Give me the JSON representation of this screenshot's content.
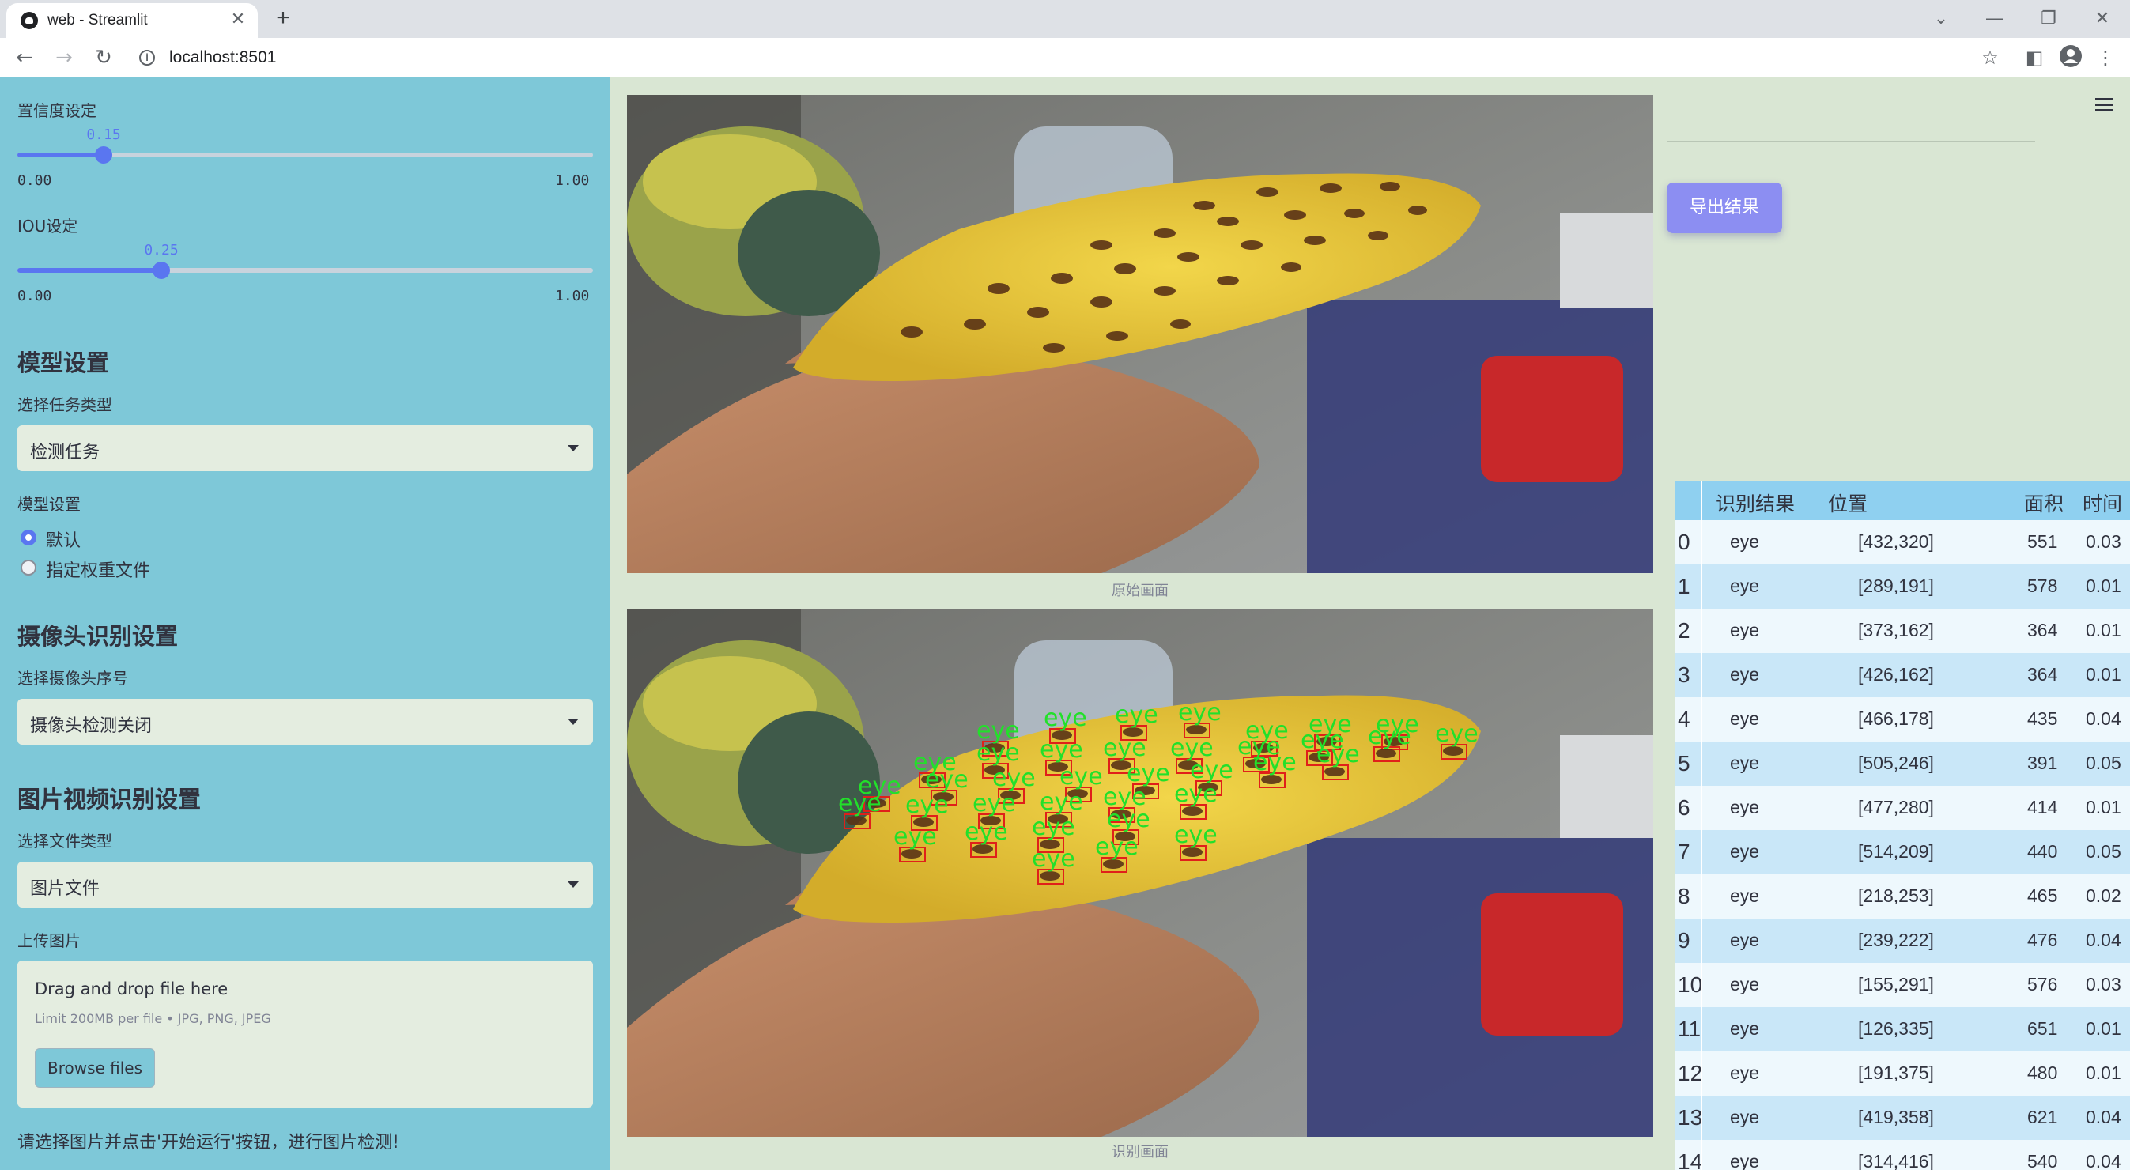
{
  "browser": {
    "tab_title": "web - Streamlit",
    "tab_close": "✕",
    "new_tab": "+",
    "url": "localhost:8501",
    "info_glyph": "i",
    "window_controls": [
      "⌄",
      "—",
      "❐",
      "✕"
    ]
  },
  "sidebar": {
    "confidence": {
      "label": "置信度设定",
      "value": "0.15",
      "value_num": 0.15,
      "min": "0.00",
      "max": "1.00"
    },
    "iou": {
      "label": "IOU设定",
      "value": "0.25",
      "value_num": 0.25,
      "min": "0.00",
      "max": "1.00"
    },
    "model_section": {
      "heading": "模型设置",
      "task_label": "选择任务类型",
      "task_value": "检测任务",
      "model_label": "模型设置",
      "options": [
        "默认",
        "指定权重文件"
      ],
      "selected": "默认"
    },
    "camera_section": {
      "heading": "摄像头识别设置",
      "camera_label": "选择摄像头序号",
      "camera_value": "摄像头检测关闭"
    },
    "media_section": {
      "heading": "图片视频识别设置",
      "file_type_label": "选择文件类型",
      "file_type_value": "图片文件",
      "upload_label": "上传图片",
      "drop_text": "Drag and drop file here",
      "limit_text": "Limit 200MB per file • JPG, PNG, JPEG",
      "browse_label": "Browse files"
    },
    "hint": "请选择图片并点击'开始运行'按钮，进行图片检测!"
  },
  "main": {
    "original_caption": "原始画面",
    "detected_caption": "识别画面",
    "export_label": "导出结果",
    "detection_label": "eye",
    "detection_color": "#22e02a",
    "box_color": "#e0201a"
  },
  "table": {
    "columns": [
      "",
      "识别结果",
      "位置",
      "面积",
      "时间"
    ],
    "rows": [
      {
        "idx": "0",
        "result": "eye",
        "pos": "[432,320]",
        "area": "551",
        "time": "0.03"
      },
      {
        "idx": "1",
        "result": "eye",
        "pos": "[289,191]",
        "area": "578",
        "time": "0.01"
      },
      {
        "idx": "2",
        "result": "eye",
        "pos": "[373,162]",
        "area": "364",
        "time": "0.01"
      },
      {
        "idx": "3",
        "result": "eye",
        "pos": "[426,162]",
        "area": "364",
        "time": "0.01"
      },
      {
        "idx": "4",
        "result": "eye",
        "pos": "[466,178]",
        "area": "435",
        "time": "0.04"
      },
      {
        "idx": "5",
        "result": "eye",
        "pos": "[505,246]",
        "area": "391",
        "time": "0.05"
      },
      {
        "idx": "6",
        "result": "eye",
        "pos": "[477,280]",
        "area": "414",
        "time": "0.01"
      },
      {
        "idx": "7",
        "result": "eye",
        "pos": "[514,209]",
        "area": "440",
        "time": "0.05"
      },
      {
        "idx": "8",
        "result": "eye",
        "pos": "[218,253]",
        "area": "465",
        "time": "0.02"
      },
      {
        "idx": "9",
        "result": "eye",
        "pos": "[239,222]",
        "area": "476",
        "time": "0.04"
      },
      {
        "idx": "10",
        "result": "eye",
        "pos": "[155,291]",
        "area": "576",
        "time": "0.03"
      },
      {
        "idx": "11",
        "result": "eye",
        "pos": "[126,335]",
        "area": "651",
        "time": "0.01"
      },
      {
        "idx": "12",
        "result": "eye",
        "pos": "[191,375]",
        "area": "480",
        "time": "0.01"
      },
      {
        "idx": "13",
        "result": "eye",
        "pos": "[419,358]",
        "area": "621",
        "time": "0.04"
      },
      {
        "idx": "14",
        "result": "eye",
        "pos": "[314,416]",
        "area": "540",
        "time": "0.04"
      }
    ]
  }
}
